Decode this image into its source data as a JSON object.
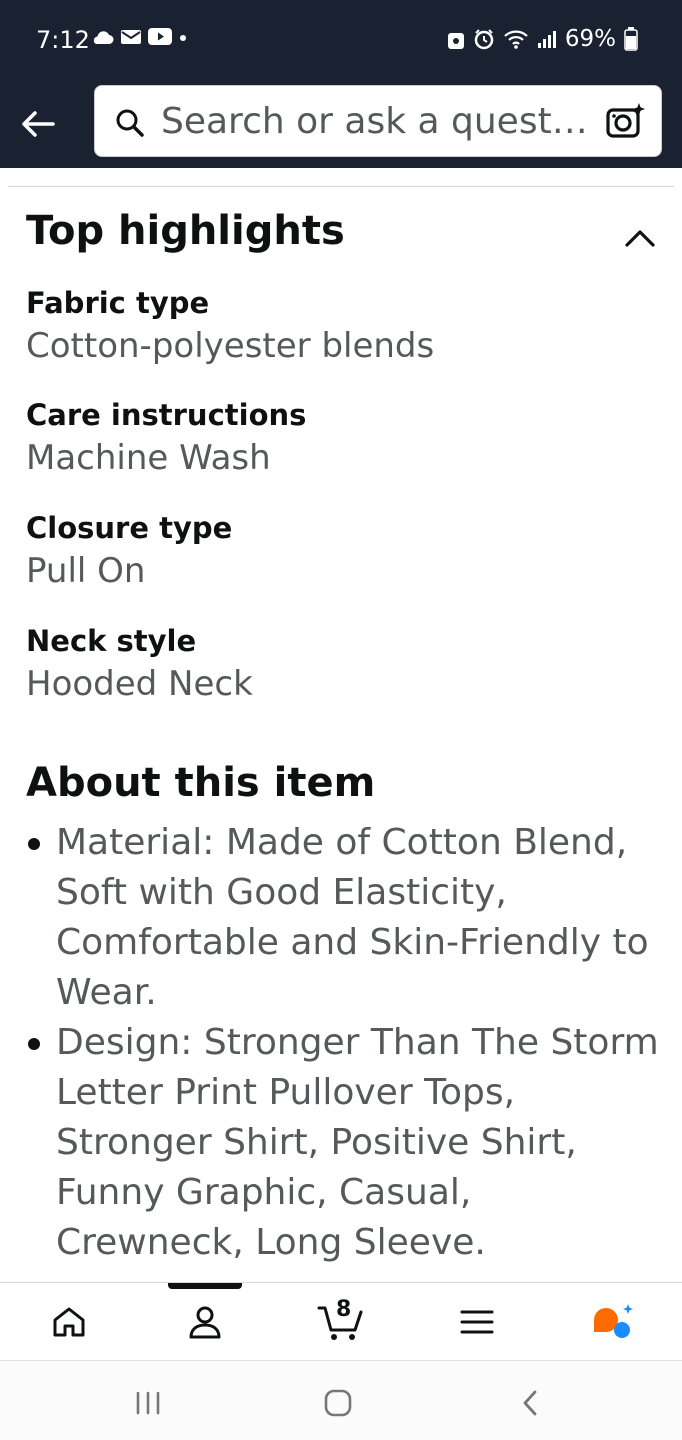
{
  "status_bar": {
    "time": "7:12",
    "battery": "69%"
  },
  "search": {
    "placeholder": "Search or ask a question"
  },
  "top_highlights": {
    "title": "Top highlights",
    "specs": [
      {
        "label": "Fabric type",
        "value": "Cotton-polyester blends"
      },
      {
        "label": "Care instructions",
        "value": "Machine Wash"
      },
      {
        "label": "Closure type",
        "value": "Pull On"
      },
      {
        "label": "Neck style",
        "value": "Hooded Neck"
      }
    ]
  },
  "about": {
    "title": "About this item",
    "bullets": [
      "Material: Made of Cotton Blend, Soft with Good Elasticity, Comfortable and Skin-Friendly to Wear.",
      "Design: Stronger Than The Storm Letter Print Pullover Tops, Stronger Shirt, Positive Shirt, Funny Graphic, Casual, Crewneck, Long Sleeve."
    ]
  },
  "bottom_nav": {
    "cart_count": "8"
  },
  "colors": {
    "header_bg": "#1a2231",
    "text_primary": "#0f1111",
    "text_secondary": "#565959",
    "rufus_orange": "#ff6a00",
    "rufus_blue": "#1a8cff"
  }
}
